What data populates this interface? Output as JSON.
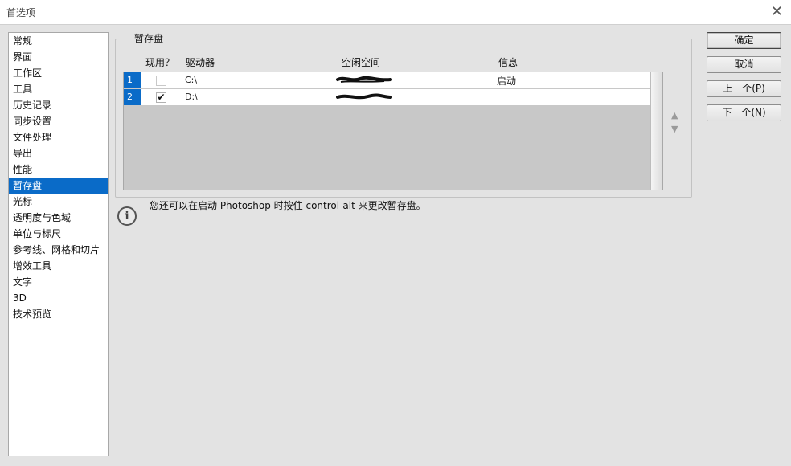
{
  "window": {
    "title": "首选项"
  },
  "sidebar": {
    "items": [
      {
        "label": "常规"
      },
      {
        "label": "界面"
      },
      {
        "label": "工作区"
      },
      {
        "label": "工具"
      },
      {
        "label": "历史记录"
      },
      {
        "label": "同步设置"
      },
      {
        "label": "文件处理"
      },
      {
        "label": "导出"
      },
      {
        "label": "性能"
      },
      {
        "label": "暂存盘",
        "selected": true
      },
      {
        "label": "光标"
      },
      {
        "label": "透明度与色域"
      },
      {
        "label": "单位与标尺"
      },
      {
        "label": "参考线、网格和切片"
      },
      {
        "label": "增效工具"
      },
      {
        "label": "文字"
      },
      {
        "label": "3D"
      },
      {
        "label": "技术预览"
      }
    ]
  },
  "scratch": {
    "group_title": "暂存盘",
    "columns": {
      "active": "现用？",
      "drive": "驱动器",
      "free_space": "空闲空间",
      "info": "信息"
    },
    "rows": [
      {
        "index": "1",
        "active": false,
        "drive": "C:\\",
        "free_space_redacted": true,
        "info": "启动"
      },
      {
        "index": "2",
        "active": true,
        "check_mark": "✔",
        "drive": "D:\\",
        "free_space_redacted": true,
        "info": ""
      }
    ],
    "hint": "您还可以在启动 Photoshop 时按住 control-alt 来更改暂存盘。"
  },
  "buttons": {
    "ok": "确定",
    "cancel": "取消",
    "prev": "上一个(P)",
    "next": "下一个(N)"
  },
  "colors": {
    "selection": "#0a6bc8",
    "dialog_bg": "#e3e3e3",
    "table_bg": "#c8c8c8"
  }
}
